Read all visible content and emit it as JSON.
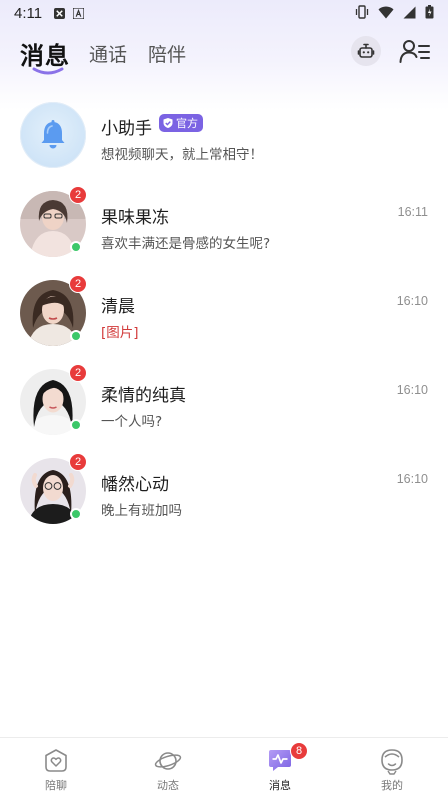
{
  "status_bar": {
    "time": "4:11"
  },
  "header": {
    "tabs": [
      {
        "label": "消息",
        "active": true
      },
      {
        "label": "通话",
        "active": false
      },
      {
        "label": "陪伴",
        "active": false
      }
    ],
    "robot_icon": "robot-icon",
    "contacts_icon": "contacts-list-icon"
  },
  "conversations": [
    {
      "name": "小助手",
      "badge": "官方",
      "preview": "想视频聊天，就上常相守！",
      "time": "",
      "unread": "",
      "online": false,
      "avatar": "bell-icon"
    },
    {
      "name": "果味果冻",
      "badge": "",
      "preview": "喜欢丰满还是骨感的女生呢?",
      "time": "16:11",
      "unread": "2",
      "online": true
    },
    {
      "name": "清晨",
      "badge": "",
      "preview": "[图片]",
      "time": "16:10",
      "unread": "2",
      "online": true
    },
    {
      "name": "柔情的纯真",
      "badge": "",
      "preview": "一个人吗?",
      "time": "16:10",
      "unread": "2",
      "online": true
    },
    {
      "name": "幡然心动",
      "badge": "",
      "preview": "晚上有班加吗",
      "time": "16:10",
      "unread": "2",
      "online": true
    }
  ],
  "bottom_nav": [
    {
      "label": "陪聊",
      "icon": "heart-chat-icon",
      "active": false,
      "badge": ""
    },
    {
      "label": "动态",
      "icon": "planet-icon",
      "active": false,
      "badge": ""
    },
    {
      "label": "消息",
      "icon": "message-pulse-icon",
      "active": true,
      "badge": "8"
    },
    {
      "label": "我的",
      "icon": "profile-face-icon",
      "active": false,
      "badge": ""
    }
  ],
  "colors": {
    "accent": "#7b63e3",
    "unread_badge": "#e83b3b",
    "online_dot": "#3cc869",
    "header_bg": "#ecebfb"
  }
}
